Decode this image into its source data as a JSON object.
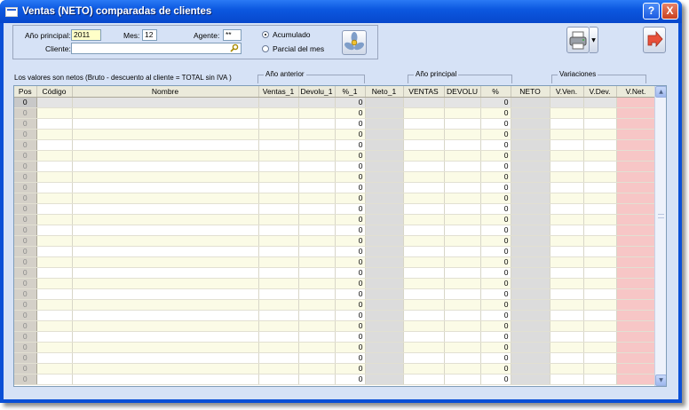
{
  "window": {
    "title": "Ventas (NETO) comparadas de clientes",
    "help_glyph": "?",
    "close_glyph": "X"
  },
  "filters": {
    "anio_label": "Año principal:",
    "anio_value": "2011",
    "mes_label": "Mes:",
    "mes_value": "12",
    "agente_label": "Agente:",
    "agente_value": "**",
    "cliente_label": "Cliente:",
    "cliente_value": "",
    "radio_acumulado": "Acumulado",
    "radio_parcial": "Parcial del mes",
    "selected_radio": "Acumulado"
  },
  "note": "Los valores son netos (Bruto - descuento al cliente = TOTAL sin IVA )",
  "groups": {
    "anterior": "Año anterior",
    "principal": "Año principal",
    "variaciones": "Variaciones"
  },
  "columns": [
    "Pos",
    "Código",
    "Nombre",
    "Ventas_1",
    "Devolu_1",
    "%_1",
    "Neto_1",
    "VENTAS",
    "DEVOLU",
    "%",
    "NETO",
    "V.Ven.",
    "V.Dev.",
    "V.Net."
  ],
  "rows": [
    [
      "0",
      "",
      "",
      "",
      "",
      "0",
      "",
      "",
      "",
      "0",
      "",
      "",
      "",
      ""
    ],
    [
      "0",
      "",
      "",
      "",
      "",
      "0",
      "",
      "",
      "",
      "0",
      "",
      "",
      "",
      ""
    ],
    [
      "0",
      "",
      "",
      "",
      "",
      "0",
      "",
      "",
      "",
      "0",
      "",
      "",
      "",
      ""
    ],
    [
      "0",
      "",
      "",
      "",
      "",
      "0",
      "",
      "",
      "",
      "0",
      "",
      "",
      "",
      ""
    ],
    [
      "0",
      "",
      "",
      "",
      "",
      "0",
      "",
      "",
      "",
      "0",
      "",
      "",
      "",
      ""
    ],
    [
      "0",
      "",
      "",
      "",
      "",
      "0",
      "",
      "",
      "",
      "0",
      "",
      "",
      "",
      ""
    ],
    [
      "0",
      "",
      "",
      "",
      "",
      "0",
      "",
      "",
      "",
      "0",
      "",
      "",
      "",
      ""
    ],
    [
      "0",
      "",
      "",
      "",
      "",
      "0",
      "",
      "",
      "",
      "0",
      "",
      "",
      "",
      ""
    ],
    [
      "0",
      "",
      "",
      "",
      "",
      "0",
      "",
      "",
      "",
      "0",
      "",
      "",
      "",
      ""
    ],
    [
      "0",
      "",
      "",
      "",
      "",
      "0",
      "",
      "",
      "",
      "0",
      "",
      "",
      "",
      ""
    ],
    [
      "0",
      "",
      "",
      "",
      "",
      "0",
      "",
      "",
      "",
      "0",
      "",
      "",
      "",
      ""
    ],
    [
      "0",
      "",
      "",
      "",
      "",
      "0",
      "",
      "",
      "",
      "0",
      "",
      "",
      "",
      ""
    ],
    [
      "0",
      "",
      "",
      "",
      "",
      "0",
      "",
      "",
      "",
      "0",
      "",
      "",
      "",
      ""
    ],
    [
      "0",
      "",
      "",
      "",
      "",
      "0",
      "",
      "",
      "",
      "0",
      "",
      "",
      "",
      ""
    ],
    [
      "0",
      "",
      "",
      "",
      "",
      "0",
      "",
      "",
      "",
      "0",
      "",
      "",
      "",
      ""
    ],
    [
      "0",
      "",
      "",
      "",
      "",
      "0",
      "",
      "",
      "",
      "0",
      "",
      "",
      "",
      ""
    ],
    [
      "0",
      "",
      "",
      "",
      "",
      "0",
      "",
      "",
      "",
      "0",
      "",
      "",
      "",
      ""
    ],
    [
      "0",
      "",
      "",
      "",
      "",
      "0",
      "",
      "",
      "",
      "0",
      "",
      "",
      "",
      ""
    ],
    [
      "0",
      "",
      "",
      "",
      "",
      "0",
      "",
      "",
      "",
      "0",
      "",
      "",
      "",
      ""
    ],
    [
      "0",
      "",
      "",
      "",
      "",
      "0",
      "",
      "",
      "",
      "0",
      "",
      "",
      "",
      ""
    ],
    [
      "0",
      "",
      "",
      "",
      "",
      "0",
      "",
      "",
      "",
      "0",
      "",
      "",
      "",
      ""
    ],
    [
      "0",
      "",
      "",
      "",
      "",
      "0",
      "",
      "",
      "",
      "0",
      "",
      "",
      "",
      ""
    ],
    [
      "0",
      "",
      "",
      "",
      "",
      "0",
      "",
      "",
      "",
      "0",
      "",
      "",
      "",
      ""
    ],
    [
      "0",
      "",
      "",
      "",
      "",
      "0",
      "",
      "",
      "",
      "0",
      "",
      "",
      "",
      ""
    ],
    [
      "0",
      "",
      "",
      "",
      "",
      "0",
      "",
      "",
      "",
      "0",
      "",
      "",
      "",
      ""
    ],
    [
      "0",
      "",
      "",
      "",
      "",
      "0",
      "",
      "",
      "",
      "0",
      "",
      "",
      "",
      ""
    ],
    [
      "0",
      "",
      "",
      "",
      "",
      "0",
      "",
      "",
      "",
      "0",
      "",
      "",
      "",
      ""
    ]
  ],
  "icons": {
    "search": "search-icon",
    "fan": "fan-icon",
    "printer": "printer-icon",
    "exit": "exit-arrow-icon"
  },
  "colors": {
    "titlebar": "#0a4fd6",
    "client_bg": "#d6e2f6",
    "vnet_column": "#f7c6c6",
    "neto_column": "#dcdcdc",
    "cream_row": "#fbfbe6"
  }
}
